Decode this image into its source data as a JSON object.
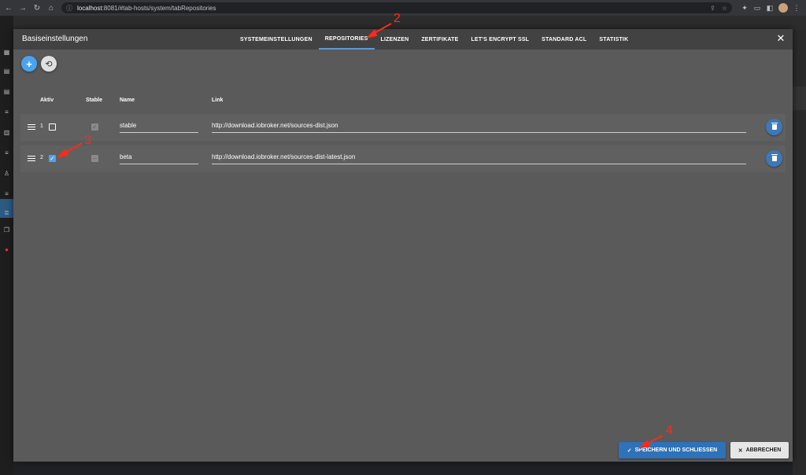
{
  "browser": {
    "url_host": "localhost",
    "url_path": ":8081/#tab-hosts/system/tabRepositories"
  },
  "dialog": {
    "title": "Basiseinstellungen",
    "tabs": [
      {
        "label": "SYSTEMEINSTELLUNGEN",
        "active": false
      },
      {
        "label": "REPOSITORIES",
        "active": true
      },
      {
        "label": "LIZENZEN",
        "active": false
      },
      {
        "label": "ZERTIFIKATE",
        "active": false
      },
      {
        "label": "LET'S ENCRYPT SSL",
        "active": false
      },
      {
        "label": "STANDARD ACL",
        "active": false
      },
      {
        "label": "STATISTIK",
        "active": false
      }
    ],
    "add_symbol": "+",
    "restore_symbol": "⟲",
    "close_symbol": "✕"
  },
  "table": {
    "headers": {
      "active": "Aktiv",
      "stable": "Stable",
      "name": "Name",
      "link": "Link"
    },
    "rows": [
      {
        "number": "1",
        "active": false,
        "stable": true,
        "name": "stable",
        "link": "http://download.iobroker.net/sources-dist.json"
      },
      {
        "number": "2",
        "active": true,
        "stable": false,
        "name": "beta",
        "link": "http://download.iobroker.net/sources-dist-latest.json"
      }
    ]
  },
  "footer": {
    "save_label": "SPEICHERN UND SCHLIESSEN",
    "save_icon": "✓",
    "cancel_label": "ABBRECHEN",
    "cancel_icon": "✕"
  },
  "annotations": {
    "tab_marker": "2",
    "checkbox_marker": "3",
    "save_marker": "4",
    "color": "#ff2a1a"
  },
  "colors": {
    "accent": "#4aa3f0",
    "primary_button": "#2e72b8",
    "dialog_bg": "#5a5a5a",
    "header_bg": "#424242"
  }
}
